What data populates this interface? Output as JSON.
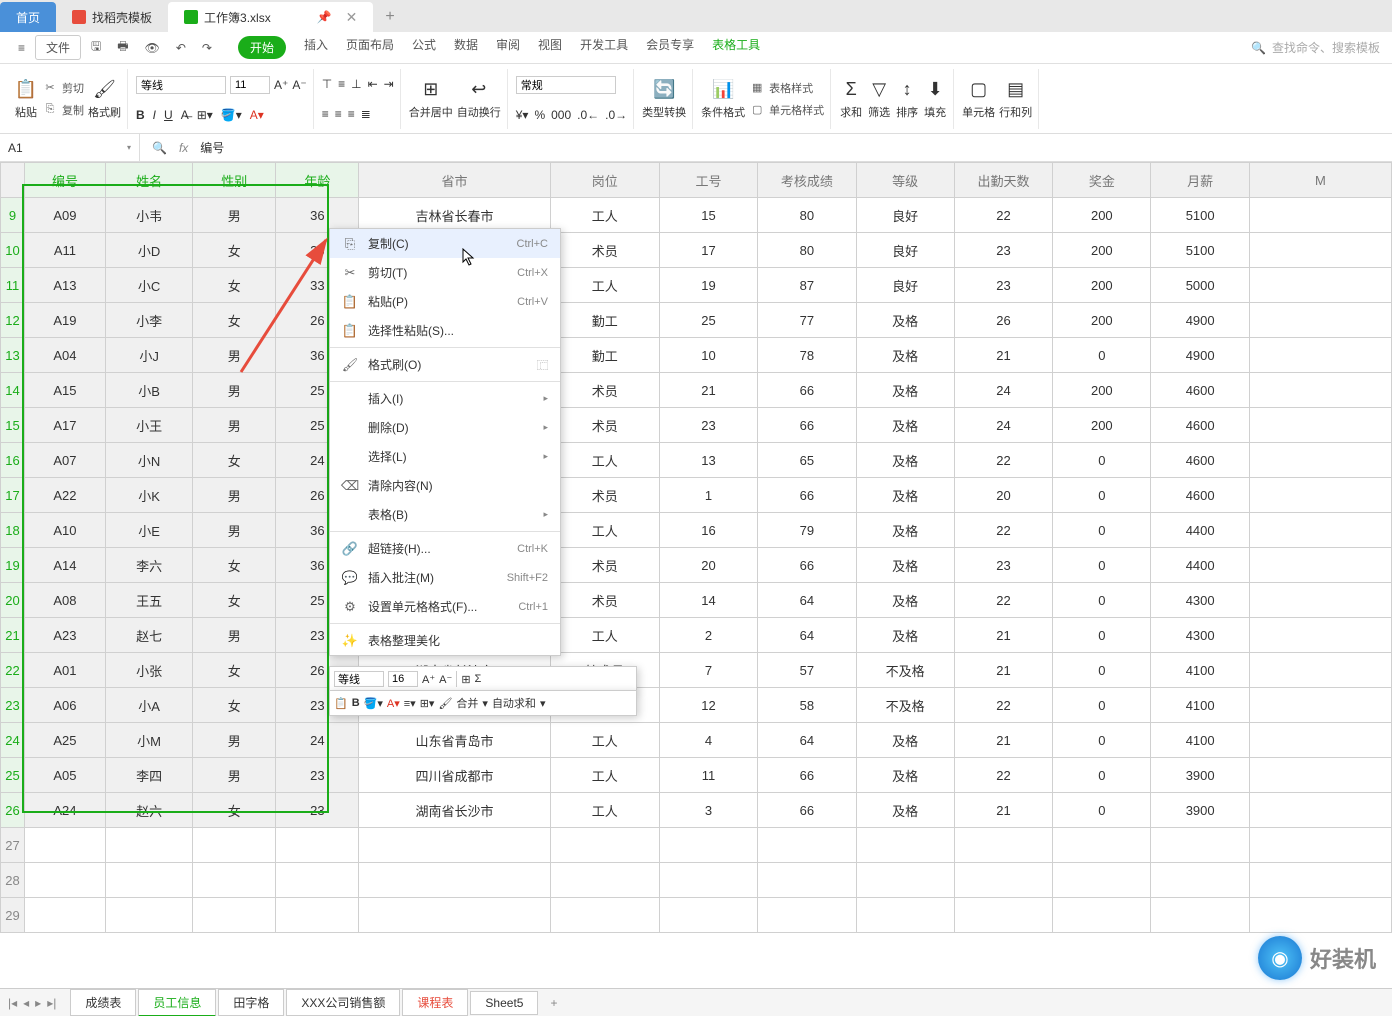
{
  "titleTabs": {
    "home": "首页",
    "template": "找稻壳模板",
    "workbook": "工作簿3.xlsx"
  },
  "menuBar": {
    "file": "文件",
    "tabs": [
      "开始",
      "插入",
      "页面布局",
      "公式",
      "数据",
      "审阅",
      "视图",
      "开发工具",
      "会员专享",
      "表格工具"
    ],
    "searchPlaceholder": "查找命令、搜索模板"
  },
  "ribbon": {
    "paste": "粘贴",
    "cut": "剪切",
    "copy": "复制",
    "formatPainter": "格式刷",
    "font": "等线",
    "fontSize": "11",
    "mergeCenter": "合并居中",
    "autoWrap": "自动换行",
    "general": "常规",
    "typeConvert": "类型转换",
    "condFormat": "条件格式",
    "tableStyle": "表格样式",
    "cellStyle": "单元格样式",
    "sum": "求和",
    "filter": "筛选",
    "sort": "排序",
    "fill": "填充",
    "cell": "单元格",
    "rowCol": "行和列"
  },
  "formulaBar": {
    "cellRef": "A1",
    "value": "编号"
  },
  "headers": [
    "编号",
    "姓名",
    "性别",
    "年龄",
    "省市",
    "岗位",
    "工号",
    "考核成绩",
    "等级",
    "出勤天数",
    "奖金",
    "月薪",
    "M"
  ],
  "rows": [
    {
      "n": 9,
      "id": "A09",
      "name": "小韦",
      "g": "男",
      "age": 36,
      "city": "吉林省长春市",
      "job": "工人",
      "wid": 15,
      "score": 80,
      "grade": "良好",
      "days": 22,
      "bonus": 200,
      "salary": 5100
    },
    {
      "n": 10,
      "id": "A11",
      "name": "小D",
      "g": "女",
      "age": 28,
      "city": "",
      "job": "术员",
      "wid": 17,
      "score": 80,
      "grade": "良好",
      "days": 23,
      "bonus": 200,
      "salary": 5100
    },
    {
      "n": 11,
      "id": "A13",
      "name": "小C",
      "g": "女",
      "age": 33,
      "city": "",
      "job": "工人",
      "wid": 19,
      "score": 87,
      "grade": "良好",
      "days": 23,
      "bonus": 200,
      "salary": 5000
    },
    {
      "n": 12,
      "id": "A19",
      "name": "小李",
      "g": "女",
      "age": 26,
      "city": "",
      "job": "勤工",
      "wid": 25,
      "score": 77,
      "grade": "及格",
      "days": 26,
      "bonus": 200,
      "salary": 4900
    },
    {
      "n": 13,
      "id": "A04",
      "name": "小J",
      "g": "男",
      "age": 36,
      "city": "",
      "job": "勤工",
      "wid": 10,
      "score": 78,
      "grade": "及格",
      "days": 21,
      "bonus": 0,
      "salary": 4900
    },
    {
      "n": 14,
      "id": "A15",
      "name": "小B",
      "g": "男",
      "age": 25,
      "city": "",
      "job": "术员",
      "wid": 21,
      "score": 66,
      "grade": "及格",
      "days": 24,
      "bonus": 200,
      "salary": 4600
    },
    {
      "n": 15,
      "id": "A17",
      "name": "小王",
      "g": "男",
      "age": 25,
      "city": "",
      "job": "术员",
      "wid": 23,
      "score": 66,
      "grade": "及格",
      "days": 24,
      "bonus": 200,
      "salary": 4600
    },
    {
      "n": 16,
      "id": "A07",
      "name": "小N",
      "g": "女",
      "age": 24,
      "city": "",
      "job": "工人",
      "wid": 13,
      "score": 65,
      "grade": "及格",
      "days": 22,
      "bonus": 0,
      "salary": 4600
    },
    {
      "n": 17,
      "id": "A22",
      "name": "小K",
      "g": "男",
      "age": 26,
      "city": "",
      "job": "术员",
      "wid": 1,
      "score": 66,
      "grade": "及格",
      "days": 20,
      "bonus": 0,
      "salary": 4600
    },
    {
      "n": 18,
      "id": "A10",
      "name": "小E",
      "g": "男",
      "age": 36,
      "city": "",
      "job": "工人",
      "wid": 16,
      "score": 79,
      "grade": "及格",
      "days": 22,
      "bonus": 0,
      "salary": 4400
    },
    {
      "n": 19,
      "id": "A14",
      "name": "李六",
      "g": "女",
      "age": 36,
      "city": "",
      "job": "术员",
      "wid": 20,
      "score": 66,
      "grade": "及格",
      "days": 23,
      "bonus": 0,
      "salary": 4400
    },
    {
      "n": 20,
      "id": "A08",
      "name": "王五",
      "g": "女",
      "age": 25,
      "city": "",
      "job": "术员",
      "wid": 14,
      "score": 64,
      "grade": "及格",
      "days": 22,
      "bonus": 0,
      "salary": 4300
    },
    {
      "n": 21,
      "id": "A23",
      "name": "赵七",
      "g": "男",
      "age": 23,
      "city": "",
      "job": "工人",
      "wid": 2,
      "score": 64,
      "grade": "及格",
      "days": 21,
      "bonus": 0,
      "salary": 4300
    },
    {
      "n": 22,
      "id": "A01",
      "name": "小张",
      "g": "女",
      "age": 26,
      "city": "湖南省长沙市",
      "job": "技术员",
      "wid": 7,
      "score": 57,
      "grade": "不及格",
      "days": 21,
      "bonus": 0,
      "salary": 4100
    },
    {
      "n": 23,
      "id": "A06",
      "name": "小A",
      "g": "女",
      "age": 23,
      "city": "",
      "job": "",
      "wid": 12,
      "score": 58,
      "grade": "不及格",
      "days": 22,
      "bonus": 0,
      "salary": 4100
    },
    {
      "n": 24,
      "id": "A25",
      "name": "小M",
      "g": "男",
      "age": 24,
      "city": "山东省青岛市",
      "job": "工人",
      "wid": 4,
      "score": 64,
      "grade": "及格",
      "days": 21,
      "bonus": 0,
      "salary": 4100
    },
    {
      "n": 25,
      "id": "A05",
      "name": "李四",
      "g": "男",
      "age": 23,
      "city": "四川省成都市",
      "job": "工人",
      "wid": 11,
      "score": 66,
      "grade": "及格",
      "days": 22,
      "bonus": 0,
      "salary": 3900
    },
    {
      "n": 26,
      "id": "A24",
      "name": "赵六",
      "g": "女",
      "age": 23,
      "city": "湖南省长沙市",
      "job": "工人",
      "wid": 3,
      "score": 66,
      "grade": "及格",
      "days": 21,
      "bonus": 0,
      "salary": 3900
    }
  ],
  "emptyRows": [
    27,
    28,
    29
  ],
  "contextMenu": {
    "copy": "复制(C)",
    "copyKey": "Ctrl+C",
    "cut": "剪切(T)",
    "cutKey": "Ctrl+X",
    "paste": "粘贴(P)",
    "pasteKey": "Ctrl+V",
    "pasteSpecial": "选择性粘贴(S)...",
    "formatPainter": "格式刷(O)",
    "insert": "插入(I)",
    "delete": "删除(D)",
    "select": "选择(L)",
    "clear": "清除内容(N)",
    "table": "表格(B)",
    "hyperlink": "超链接(H)...",
    "hyperlinkKey": "Ctrl+K",
    "comment": "插入批注(M)",
    "commentKey": "Shift+F2",
    "cellFormat": "设置单元格格式(F)...",
    "cellFormatKey": "Ctrl+1",
    "beautify": "表格整理美化"
  },
  "miniToolbar": {
    "font": "等线",
    "size": "16",
    "merge": "合并",
    "autoSum": "自动求和"
  },
  "sheetTabs": [
    "成绩表",
    "员工信息",
    "田字格",
    "XXX公司销售额",
    "课程表",
    "Sheet5"
  ],
  "watermark": "好装机"
}
